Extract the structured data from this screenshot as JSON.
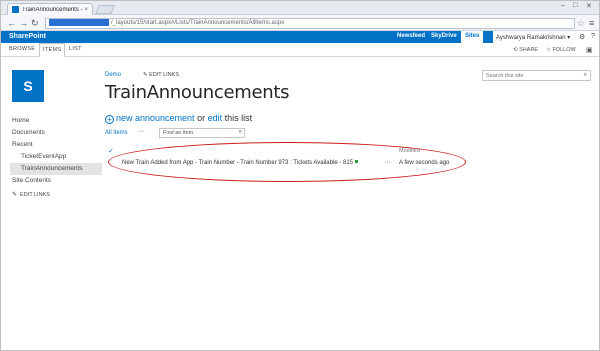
{
  "browser": {
    "tab_title": "TrainAnnouncements - All items",
    "tab_close": "×",
    "address": "/_layouts/15/start.aspx#/Lists/TrainAnnouncements/AllItems.aspx"
  },
  "suite": {
    "brand": "SharePoint",
    "links": [
      "Newsfeed",
      "SkyDrive",
      "Sites"
    ],
    "user": "Ayshwarya Ramakrishnan ▾"
  },
  "ribbon": {
    "tabs": [
      "BROWSE",
      "ITEMS",
      "LIST"
    ],
    "share": "SHARE",
    "follow": "FOLLOW"
  },
  "leftnav": {
    "items": [
      "Home",
      "Documents",
      "Recent"
    ],
    "recent": [
      "TicketEventApp",
      "TrainAnnouncements"
    ],
    "site_contents": "Site Contents",
    "edit_links": "EDIT LINKS"
  },
  "page": {
    "breadcrumb": "Demo",
    "edit_links": "EDIT LINKS",
    "title": "TrainAnnouncements",
    "search_placeholder": "Search this site",
    "new_link": "new announcement",
    "or_text": " or ",
    "edit_link": "edit",
    "this_list": " this list",
    "view_label": "All items",
    "find_placeholder": "Find an item"
  },
  "list": {
    "header_check": "✓",
    "col_modified": "Modified",
    "rows": [
      {
        "title": "New Train Added from App - Train Number - Train Number 973 : Tickets Available - 815",
        "modified": "A few seconds ago"
      }
    ]
  },
  "colors": {
    "accent": "#0072c6",
    "annotation": "#cc1a1a"
  }
}
